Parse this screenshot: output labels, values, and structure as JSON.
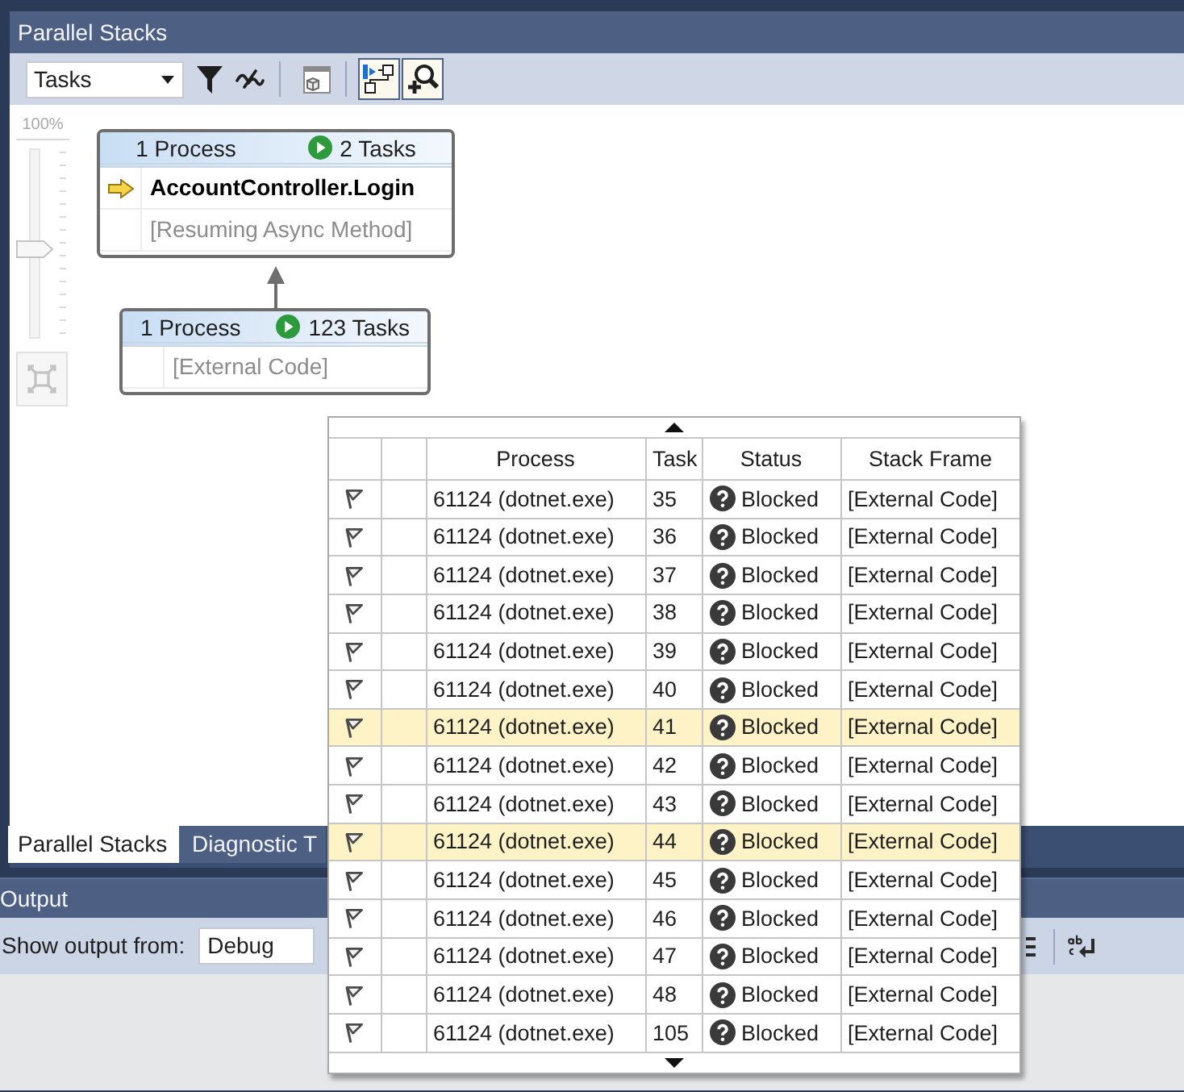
{
  "window": {
    "title": "Parallel Stacks"
  },
  "toolbar": {
    "view": "Tasks",
    "buttons": [
      {
        "kind": "filter",
        "on": false
      },
      {
        "kind": "wavy",
        "on": false
      },
      {
        "kind": "cube",
        "on": false
      },
      {
        "kind": "diagram",
        "on": true
      },
      {
        "kind": "magnifier",
        "on": true
      }
    ]
  },
  "zoom": {
    "label": "100%",
    "level": 0.47
  },
  "diagram": {
    "nodes": [
      {
        "process": "1 Process",
        "tasks": "2 Tasks",
        "frames": [
          {
            "kind": "method",
            "text": "AccountController.Login",
            "current": true
          },
          {
            "kind": "note",
            "text": "[Resuming Async Method]",
            "current": false
          }
        ]
      },
      {
        "process": "1 Process",
        "tasks": "123 Tasks",
        "frames": [
          {
            "kind": "note",
            "text": "[External Code]",
            "current": false
          }
        ]
      }
    ]
  },
  "tabs": [
    {
      "label": "Parallel Stacks",
      "selected": true
    },
    {
      "label": "Diagnostic T",
      "selected": false
    }
  ],
  "output": {
    "title": "Output",
    "source_label": "Show output from:",
    "source": "Debug"
  },
  "tasks_popup": {
    "columns": [
      "Process",
      "Task",
      "Status",
      "Stack Frame"
    ],
    "rows": [
      {
        "process": "61124 (dotnet.exe)",
        "task": "35",
        "status": "Blocked",
        "frame": "[External Code]",
        "highlighted": false
      },
      {
        "process": "61124 (dotnet.exe)",
        "task": "36",
        "status": "Blocked",
        "frame": "[External Code]",
        "highlighted": false
      },
      {
        "process": "61124 (dotnet.exe)",
        "task": "37",
        "status": "Blocked",
        "frame": "[External Code]",
        "highlighted": false
      },
      {
        "process": "61124 (dotnet.exe)",
        "task": "38",
        "status": "Blocked",
        "frame": "[External Code]",
        "highlighted": false
      },
      {
        "process": "61124 (dotnet.exe)",
        "task": "39",
        "status": "Blocked",
        "frame": "[External Code]",
        "highlighted": false
      },
      {
        "process": "61124 (dotnet.exe)",
        "task": "40",
        "status": "Blocked",
        "frame": "[External Code]",
        "highlighted": false
      },
      {
        "process": "61124 (dotnet.exe)",
        "task": "41",
        "status": "Blocked",
        "frame": "[External Code]",
        "highlighted": true
      },
      {
        "process": "61124 (dotnet.exe)",
        "task": "42",
        "status": "Blocked",
        "frame": "[External Code]",
        "highlighted": false
      },
      {
        "process": "61124 (dotnet.exe)",
        "task": "43",
        "status": "Blocked",
        "frame": "[External Code]",
        "highlighted": false
      },
      {
        "process": "61124 (dotnet.exe)",
        "task": "44",
        "status": "Blocked",
        "frame": "[External Code]",
        "highlighted": true
      },
      {
        "process": "61124 (dotnet.exe)",
        "task": "45",
        "status": "Blocked",
        "frame": "[External Code]",
        "highlighted": false
      },
      {
        "process": "61124 (dotnet.exe)",
        "task": "46",
        "status": "Blocked",
        "frame": "[External Code]",
        "highlighted": false
      },
      {
        "process": "61124 (dotnet.exe)",
        "task": "47",
        "status": "Blocked",
        "frame": "[External Code]",
        "highlighted": false
      },
      {
        "process": "61124 (dotnet.exe)",
        "task": "48",
        "status": "Blocked",
        "frame": "[External Code]",
        "highlighted": false
      },
      {
        "process": "61124 (dotnet.exe)",
        "task": "105",
        "status": "Blocked",
        "frame": "[External Code]",
        "highlighted": false
      }
    ]
  }
}
